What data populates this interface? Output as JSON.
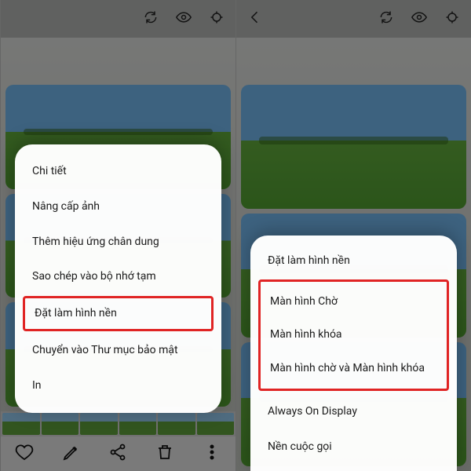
{
  "left_screen": {
    "menu": {
      "items": [
        "Chi tiết",
        "Nâng cấp ảnh",
        "Thêm hiệu ứng chân dung",
        "Sao chép vào bộ nhớ tạm",
        "Đặt làm hình nền",
        "Chuyển vào Thư mục bảo mật",
        "In"
      ],
      "highlight_index": 4
    }
  },
  "right_screen": {
    "sheet": {
      "title": "Đặt làm hình nền",
      "highlight_items": [
        "Màn hình Chờ",
        "Màn hình khóa",
        "Màn hình chờ và Màn hình khóa"
      ],
      "rest_items": [
        "Always On Display",
        "Nền cuộc gọi"
      ]
    }
  }
}
